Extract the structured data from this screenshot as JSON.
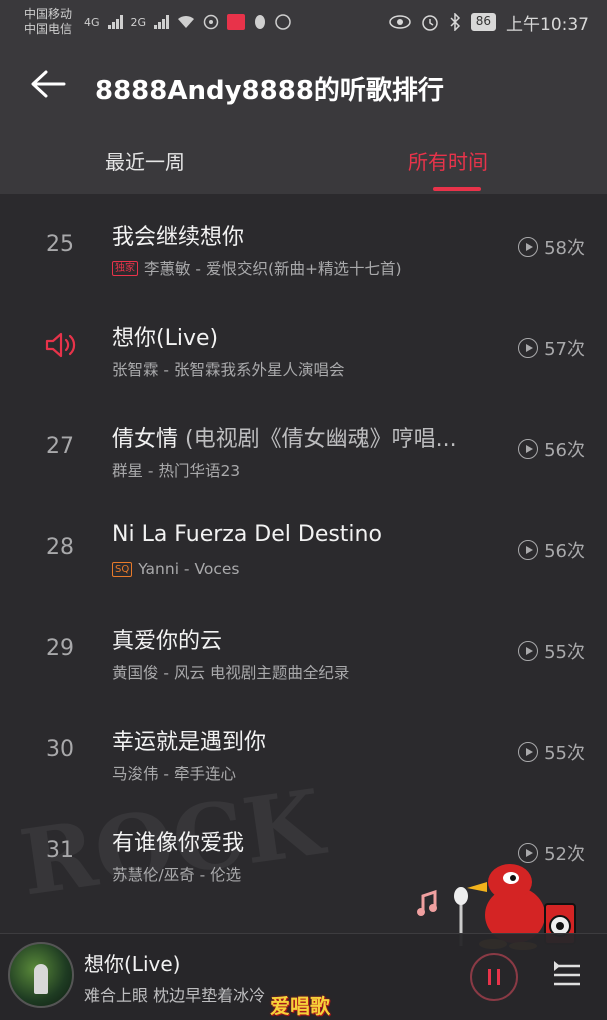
{
  "status_bar": {
    "carrier1": "中国移动",
    "carrier2": "中国电信",
    "net1": "4G",
    "net2": "2G",
    "battery": "86",
    "time": "上午10:37"
  },
  "header": {
    "title": "8888Andy8888的听歌排行"
  },
  "tabs": [
    {
      "label": "最近一周"
    },
    {
      "label": "所有时间"
    }
  ],
  "songs": [
    {
      "rank": "25",
      "title": "我会继续想你",
      "subtitle": "",
      "badge": "独家",
      "meta": "李蕙敏 - 爱恨交织(新曲+精选十七首)",
      "count": "58次"
    },
    {
      "rank": "",
      "title": "想你(Live)",
      "subtitle": "",
      "badge": "",
      "meta": "张智霖 - 张智霖我系外星人演唱会",
      "count": "57次"
    },
    {
      "rank": "27",
      "title": "倩女情 ",
      "subtitle": "(电视剧《倩女幽魂》哼唱...",
      "badge": "",
      "meta": "群星 - 热门华语23",
      "count": "56次"
    },
    {
      "rank": "28",
      "title": "Ni La Fuerza Del Destino",
      "subtitle": "",
      "badge": "SQ",
      "meta": "Yanni - Voces",
      "count": "56次"
    },
    {
      "rank": "29",
      "title": "真爱你的云",
      "subtitle": "",
      "badge": "",
      "meta": "黄国俊 - 风云 电视剧主题曲全纪录",
      "count": "55次"
    },
    {
      "rank": "30",
      "title": "幸运就是遇到你",
      "subtitle": "",
      "badge": "",
      "meta": "马浚伟 - 牵手连心",
      "count": "55次"
    },
    {
      "rank": "31",
      "title": "有谁像你爱我",
      "subtitle": "",
      "badge": "",
      "meta": "苏慧伦/巫奇 - 伦选",
      "count": "52次"
    }
  ],
  "player": {
    "title": "想你(Live)",
    "lyric": "难合上眼 枕边早垫着冰冷"
  },
  "watermark": "爱唱歌",
  "colors": {
    "accent": "#e8334a",
    "background": "#2b2a2d"
  },
  "icons": {
    "back": "arrow-left-icon",
    "playing": "speaker-icon",
    "count": "play-circle-icon",
    "pause": "pause-icon",
    "playlist": "playlist-icon"
  }
}
